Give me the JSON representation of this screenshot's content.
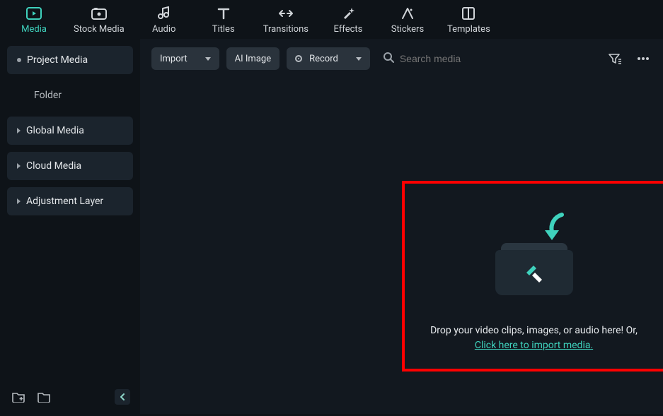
{
  "top_tabs": {
    "media": "Media",
    "stock": "Stock Media",
    "audio": "Audio",
    "titles": "Titles",
    "transitions": "Transitions",
    "effects": "Effects",
    "stickers": "Stickers",
    "templates": "Templates"
  },
  "sidebar": {
    "project_media": "Project Media",
    "folder": "Folder",
    "global_media": "Global Media",
    "cloud_media": "Cloud Media",
    "adjustment_layer": "Adjustment Layer"
  },
  "toolbar": {
    "import": "Import",
    "ai_image": "AI Image",
    "record": "Record",
    "search_placeholder": "Search media"
  },
  "drop": {
    "line1": "Drop your video clips, images, or audio here! Or,",
    "link": "Click here to import media."
  }
}
